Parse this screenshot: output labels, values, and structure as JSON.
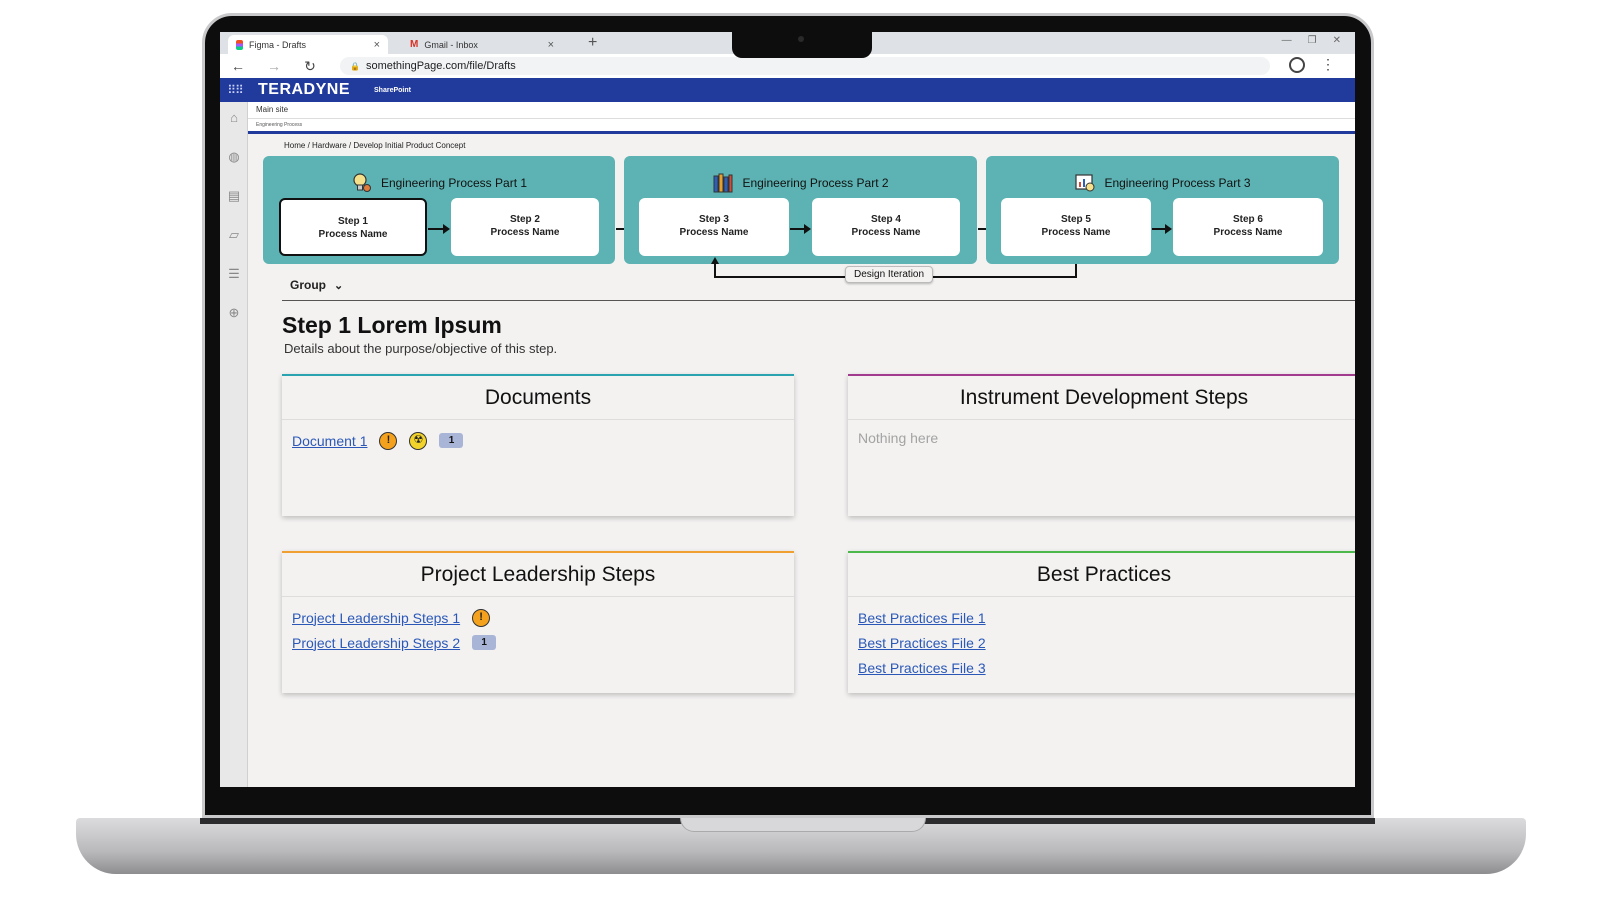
{
  "browser": {
    "tabs": [
      {
        "title": "Figma - Drafts",
        "close": "×"
      },
      {
        "title": "Gmail - Inbox",
        "close": "×"
      }
    ],
    "new_tab": "+",
    "window_controls": [
      "—",
      "❐",
      "✕"
    ],
    "url": "somethingPage.com/file/Drafts",
    "nav": {
      "back": "←",
      "forward": "→",
      "reload": "↻"
    }
  },
  "sharepoint": {
    "brand": "TERADYNE",
    "product": "SharePoint",
    "site": "Main site",
    "subsite": "Engineering Process"
  },
  "breadcrumb": "Home  /  Hardware  /  Develop Initial Product Concept",
  "process_parts": [
    {
      "title": "Engineering Process Part 1",
      "icon": "lightbulb-gear-icon",
      "steps": [
        {
          "label": "Step 1",
          "name": "Process Name",
          "selected": true
        },
        {
          "label": "Step 2",
          "name": "Process Name",
          "selected": false
        }
      ]
    },
    {
      "title": "Engineering Process Part 2",
      "icon": "books-icon",
      "steps": [
        {
          "label": "Step 3",
          "name": "Process Name",
          "selected": false
        },
        {
          "label": "Step 4",
          "name": "Process Name",
          "selected": false
        }
      ]
    },
    {
      "title": "Engineering Process Part 3",
      "icon": "analytics-icon",
      "steps": [
        {
          "label": "Step 5",
          "name": "Process Name",
          "selected": false
        },
        {
          "label": "Step 6",
          "name": "Process Name",
          "selected": false
        }
      ]
    }
  ],
  "design_iteration": "Design Iteration",
  "group_filter": {
    "label": "Group",
    "chevron": "⌄"
  },
  "step_heading": "Step 1 Lorem Ipsum",
  "step_description": "Details about the purpose/objective of this step.",
  "cards": {
    "documents": {
      "title": "Documents",
      "accent": "#2aa3b0",
      "items": [
        {
          "label": "Document 1",
          "warning": "!",
          "hazard": "☢",
          "count": "1"
        }
      ]
    },
    "instrument": {
      "title": "Instrument Development Steps",
      "accent": "#a03b8e",
      "empty_text": "Nothing here"
    },
    "leadership": {
      "title": "Project Leadership Steps",
      "accent": "#f0a030",
      "items": [
        {
          "label": "Project Leadership Steps 1",
          "warning": "!"
        },
        {
          "label": "Project Leadership Steps 2",
          "count": "1"
        }
      ]
    },
    "best_practices": {
      "title": "Best Practices",
      "accent": "#4cb84c",
      "items": [
        {
          "label": "Best Practices File 1"
        },
        {
          "label": "Best Practices File 2"
        },
        {
          "label": "Best Practices File 3"
        }
      ]
    }
  },
  "left_rail_icons": [
    "home-icon",
    "globe-icon",
    "news-icon",
    "notebook-icon",
    "list-icon",
    "add-circle-icon"
  ]
}
